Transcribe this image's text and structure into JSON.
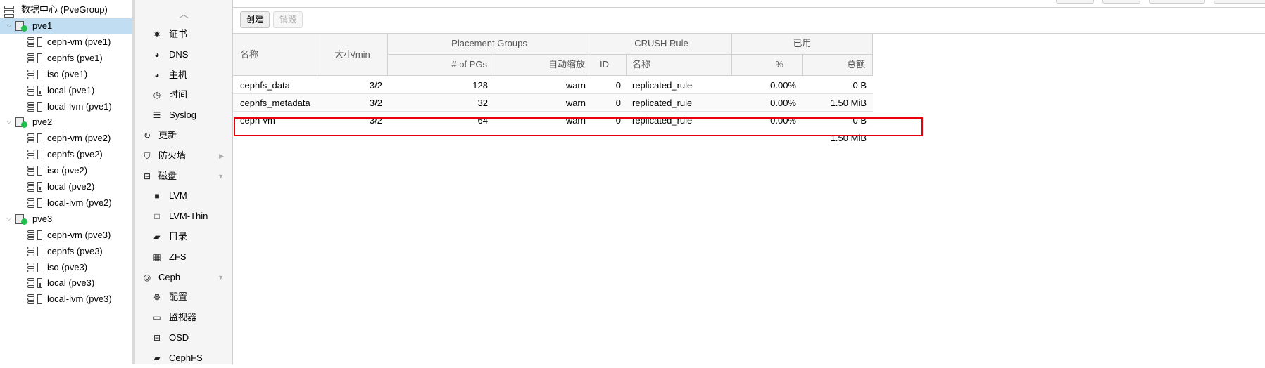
{
  "tree": {
    "datacenter": "数据中心 (PveGroup)",
    "nodes": [
      {
        "name": "pve1",
        "selected": true,
        "storages": [
          {
            "label": "ceph-vm (pve1)",
            "filled": false
          },
          {
            "label": "cephfs (pve1)",
            "filled": false
          },
          {
            "label": "iso (pve1)",
            "filled": false
          },
          {
            "label": "local (pve1)",
            "filled": true
          },
          {
            "label": "local-lvm (pve1)",
            "filled": false
          }
        ]
      },
      {
        "name": "pve2",
        "selected": false,
        "storages": [
          {
            "label": "ceph-vm (pve2)",
            "filled": false
          },
          {
            "label": "cephfs (pve2)",
            "filled": false
          },
          {
            "label": "iso (pve2)",
            "filled": false
          },
          {
            "label": "local (pve2)",
            "filled": true
          },
          {
            "label": "local-lvm (pve2)",
            "filled": false
          }
        ]
      },
      {
        "name": "pve3",
        "selected": false,
        "storages": [
          {
            "label": "ceph-vm (pve3)",
            "filled": false
          },
          {
            "label": "cephfs (pve3)",
            "filled": false
          },
          {
            "label": "iso (pve3)",
            "filled": false
          },
          {
            "label": "local (pve3)",
            "filled": true
          },
          {
            "label": "local-lvm (pve3)",
            "filled": false
          }
        ]
      }
    ]
  },
  "menu": {
    "items": [
      {
        "label": "证书",
        "icon": "certificate-icon",
        "glyph": "✹",
        "sub": true
      },
      {
        "label": "DNS",
        "icon": "globe-icon",
        "glyph": "◕",
        "sub": true
      },
      {
        "label": "主机",
        "icon": "globe-icon",
        "glyph": "◕",
        "sub": true
      },
      {
        "label": "时间",
        "icon": "clock-icon",
        "glyph": "◷",
        "sub": true
      },
      {
        "label": "Syslog",
        "icon": "list-icon",
        "glyph": "☰",
        "sub": true
      },
      {
        "label": "更新",
        "icon": "refresh-icon",
        "glyph": "↻",
        "sub": false
      },
      {
        "label": "防火墙",
        "icon": "shield-icon",
        "glyph": "⛉",
        "sub": false,
        "arrow": "▶"
      },
      {
        "label": "磁盘",
        "icon": "hdd-icon",
        "glyph": "⊟",
        "sub": false,
        "arrow": "▼"
      },
      {
        "label": "LVM",
        "icon": "square-icon",
        "glyph": "■",
        "sub": true
      },
      {
        "label": "LVM-Thin",
        "icon": "square-outline-icon",
        "glyph": "□",
        "sub": true
      },
      {
        "label": "目录",
        "icon": "folder-icon",
        "glyph": "▰",
        "sub": true
      },
      {
        "label": "ZFS",
        "icon": "grid-icon",
        "glyph": "▦",
        "sub": true
      },
      {
        "label": "Ceph",
        "icon": "ceph-icon",
        "glyph": "◎",
        "sub": false,
        "arrow": "▼"
      },
      {
        "label": "配置",
        "icon": "gear-icon",
        "glyph": "⚙",
        "sub": true
      },
      {
        "label": "监视器",
        "icon": "monitor-icon",
        "glyph": "▭",
        "sub": true
      },
      {
        "label": "OSD",
        "icon": "hdd-icon",
        "glyph": "⊟",
        "sub": true
      },
      {
        "label": "CephFS",
        "icon": "folder-icon",
        "glyph": "▰",
        "sub": true
      }
    ]
  },
  "toolbar": {
    "create_label": "创建",
    "destroy_label": "销毁"
  },
  "grid": {
    "headers": {
      "name": "名称",
      "size_min": "大小/min",
      "placement_groups": "Placement Groups",
      "pgs": "# of PGs",
      "autoscale": "自动缩放",
      "crush_rule": "CRUSH Rule",
      "crush_id": "ID",
      "crush_name": "名称",
      "used": "已用",
      "used_pct": "%",
      "used_total": "总额"
    },
    "rows": [
      {
        "name": "cephfs_data",
        "size": "3/2",
        "pgs": "128",
        "autoscale": "warn",
        "id": "0",
        "rule": "replicated_rule",
        "pct": "0.00%",
        "total": "0 B"
      },
      {
        "name": "cephfs_metadata",
        "size": "3/2",
        "pgs": "32",
        "autoscale": "warn",
        "id": "0",
        "rule": "replicated_rule",
        "pct": "0.00%",
        "total": "1.50 MiB"
      },
      {
        "name": "ceph-vm",
        "size": "3/2",
        "pgs": "64",
        "autoscale": "warn",
        "id": "0",
        "rule": "replicated_rule",
        "pct": "0.00%",
        "total": "0 B"
      }
    ],
    "summary_total": "1.50 MiB"
  },
  "colors": {
    "selected_row": "#c1ddf1",
    "highlight_border": "#e8000b",
    "status_ok": "#21bf4b"
  }
}
